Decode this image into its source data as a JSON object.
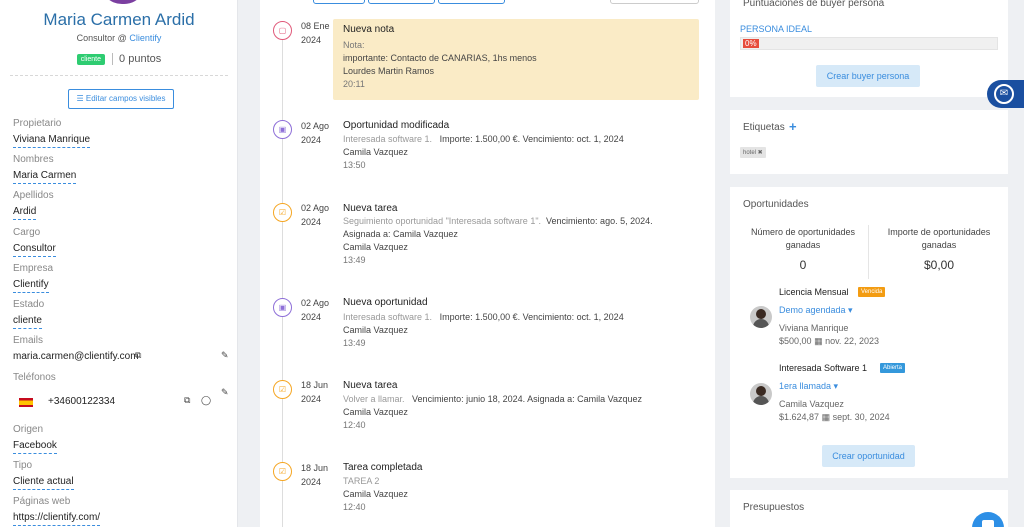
{
  "contact": {
    "name": "Maria Carmen Ardid",
    "role": "Consultor @",
    "company": "Clientify",
    "badge": "cliente",
    "points": "0 puntos",
    "edit_fields_label": "Editar campos visibles"
  },
  "fields": {
    "propietario_label": "Propietario",
    "propietario": "Viviana Manrique",
    "nombres_label": "Nombres",
    "nombres": "Maria Carmen",
    "apellidos_label": "Apellidos",
    "apellidos": "Ardid",
    "cargo_label": "Cargo",
    "cargo": "Consultor",
    "empresa_label": "Empresa",
    "empresa": "Clientify",
    "estado_label": "Estado",
    "estado": "cliente",
    "emails_label": "Emails",
    "email": "maria.carmen@clientify.com",
    "telefonos_label": "Teléfonos",
    "telefono": "+34600122334",
    "origen_label": "Origen",
    "origen": "Facebook",
    "tipo_label": "Tipo",
    "tipo": "Cliente actual",
    "paginas_label": "Páginas web",
    "pagina": "https://clientify.com/"
  },
  "timeline": [
    {
      "day": "08 Ene",
      "year": "2024",
      "title": "Nueva nota",
      "l1": "Nota:",
      "l2": "importante: Contacto de CANARIAS, 1hs menos",
      "l3": "Lourdes Martin Ramos",
      "time": "20:11"
    },
    {
      "day": "02 Ago",
      "year": "2024",
      "title": "Oportunidad modificada",
      "l1a": "Interesada software 1.",
      "l1b": "Importe: 1.500,00 €.   Vencimiento: oct. 1, 2024",
      "l2": "Camila Vazquez",
      "time": "13:50"
    },
    {
      "day": "02 Ago",
      "year": "2024",
      "title": "Nueva tarea",
      "l1a": "Seguimiento oportunidad \"Interesada software 1\".",
      "l1b": "Vencimiento: ago. 5, 2024.",
      "l2": "Asignada a: Camila Vazquez",
      "l3": "Camila Vazquez",
      "time": "13:49"
    },
    {
      "day": "02 Ago",
      "year": "2024",
      "title": "Nueva oportunidad",
      "l1a": "Interesada software 1.",
      "l1b": "Importe: 1.500,00 €.   Vencimiento: oct. 1, 2024",
      "l2": "Camila Vazquez",
      "time": "13:49"
    },
    {
      "day": "18 Jun",
      "year": "2024",
      "title": "Nueva tarea",
      "l1a": "Volver a llamar.",
      "l1b": "Vencimiento: junio 18, 2024.   Asignada a: Camila Vazquez",
      "l2": "Camila Vazquez",
      "time": "12:40"
    },
    {
      "day": "18 Jun",
      "year": "2024",
      "title": "Tarea completada",
      "l1a": "TAREA 2",
      "l2": "Camila Vazquez",
      "time": "12:40"
    }
  ],
  "buyer": {
    "title": "Puntuaciones de buyer persona",
    "persona": "PERSONA IDEAL",
    "percent_text": "0%",
    "percent": 0,
    "button": "Crear buyer persona"
  },
  "tags": {
    "title": "Etiquetas",
    "items": [
      "hotel ✖"
    ]
  },
  "opportunities": {
    "title": "Oportunidades",
    "count_label_1": "Número de oportunidades",
    "count_label_2": "ganadas",
    "count_value": "0",
    "amount_label_1": "Importe de oportunidades",
    "amount_label_2": "ganadas",
    "amount_value": "$0,00",
    "items": [
      {
        "name": "Licencia Mensual",
        "badge": "Vencida",
        "stage": "Demo agendada ▾",
        "owner": "Viviana Manrique",
        "amount": "$500,00",
        "date": "nov. 22, 2023"
      },
      {
        "name": "Interesada Software 1",
        "badge": "Abierta",
        "stage": "1era llamada ▾",
        "owner": "Camila Vazquez",
        "amount": "$1.624,87",
        "date": "sept. 30, 2024"
      }
    ],
    "button": "Crear oportunidad"
  },
  "budgets": {
    "title": "Presupuestos"
  },
  "colors": {
    "accent": "#3a8dde",
    "note_bg": "#faebc6",
    "vencida": "#f39c12",
    "abierta": "#3498db"
  }
}
